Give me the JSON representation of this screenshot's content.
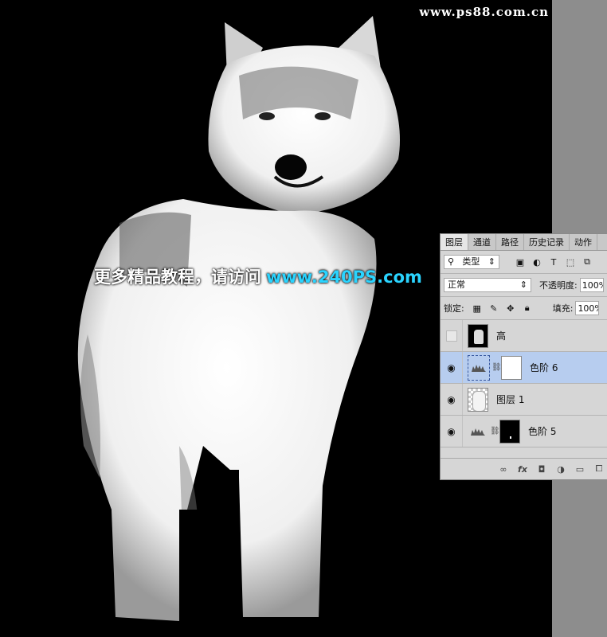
{
  "watermark": {
    "url": "www.ps88.com.cn"
  },
  "promo": {
    "chinese": "更多精品教程，请访问",
    "site": "www.240PS.com"
  },
  "panel": {
    "tabs": [
      "图层",
      "通道",
      "路径",
      "历史记录",
      "动作"
    ],
    "filter": {
      "label": "类型"
    },
    "blend": {
      "mode": "正常",
      "opacity_label": "不透明度:",
      "opacity_value": "100%"
    },
    "lock": {
      "label": "锁定:",
      "fill_label": "填充:",
      "fill_value": "100%"
    },
    "layers": [
      {
        "name": "高",
        "visible": false
      },
      {
        "name": "色阶 6",
        "visible": true,
        "selected": true
      },
      {
        "name": "图层 1",
        "visible": true
      },
      {
        "name": "色阶 5",
        "visible": true
      }
    ]
  },
  "colors": {
    "canvas": "#000000",
    "selected_layer": "#b7cdef",
    "promo_site": "#2ad4ff"
  }
}
